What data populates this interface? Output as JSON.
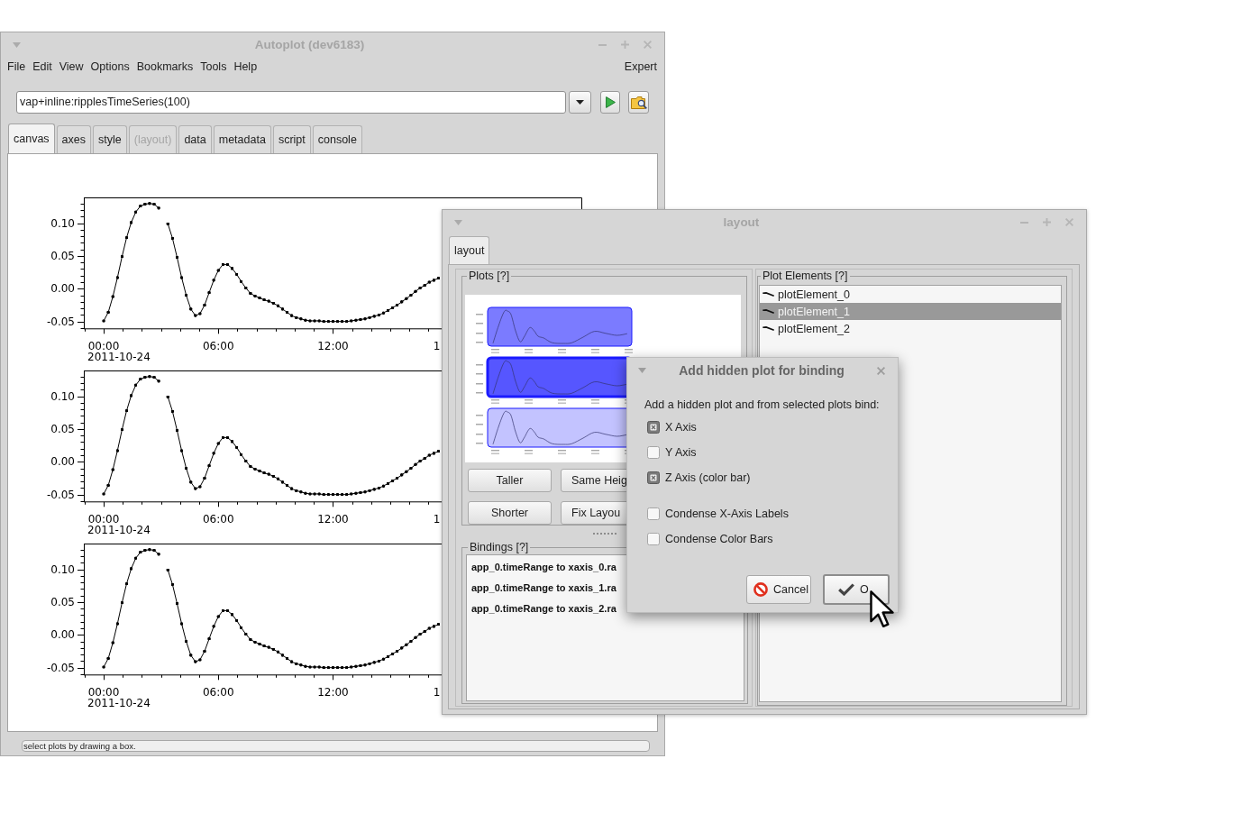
{
  "autoplot_window": {
    "title": "Autoplot (dev6183)",
    "menu": [
      "File",
      "Edit",
      "View",
      "Options",
      "Bookmarks",
      "Tools",
      "Help"
    ],
    "mode_menu": "Expert",
    "uri_field": {
      "value": "vap+inline:ripplesTimeSeries(100)"
    },
    "tabs": [
      {
        "label": "canvas",
        "selected": true,
        "disabled": false
      },
      {
        "label": "axes",
        "selected": false,
        "disabled": false
      },
      {
        "label": "style",
        "selected": false,
        "disabled": false
      },
      {
        "label": "(layout)",
        "selected": false,
        "disabled": true
      },
      {
        "label": "data",
        "selected": false,
        "disabled": false
      },
      {
        "label": "metadata",
        "selected": false,
        "disabled": false
      },
      {
        "label": "script",
        "selected": false,
        "disabled": false
      },
      {
        "label": "console",
        "selected": false,
        "disabled": false
      }
    ],
    "plots": [
      {
        "date_label": "2011-10-24",
        "cut_tick_label": "1",
        "chart_data": {
          "type": "line",
          "x": [
            0,
            0.24,
            0.48,
            0.72,
            0.96,
            1.2,
            1.44,
            1.68,
            1.92,
            2.16,
            2.4,
            2.64,
            2.88,
            3.12,
            3.36,
            3.6,
            3.84,
            4.08,
            4.32,
            4.56,
            4.8,
            5.04,
            5.28,
            5.52,
            5.76,
            6,
            6.24,
            6.48,
            6.72,
            6.96,
            7.2,
            7.44,
            7.68,
            7.92,
            8.16,
            8.4,
            8.64,
            8.88,
            9.12,
            9.36,
            9.6,
            9.84,
            10.08,
            10.32,
            10.56,
            10.8,
            11.04,
            11.28,
            11.52,
            11.76,
            12,
            12.24,
            12.48,
            12.72,
            12.96,
            13.2,
            13.44,
            13.68,
            13.92,
            14.16,
            14.4,
            14.64,
            14.88,
            15.12,
            15.36,
            15.6,
            15.84,
            16.08,
            16.32,
            16.56,
            16.8,
            17.04,
            17.28,
            17.52
          ],
          "values": [
            -0.049,
            -0.036,
            -0.012,
            0.017,
            0.049,
            0.078,
            0.101,
            0.117,
            0.126,
            0.129,
            0.13,
            0.129,
            0.123,
            null,
            0.099,
            0.077,
            0.048,
            0.017,
            -0.01,
            -0.031,
            -0.041,
            -0.038,
            -0.025,
            -0.006,
            0.013,
            0.028,
            0.037,
            0.037,
            0.031,
            0.022,
            0.011,
            0.001,
            -0.007,
            -0.011,
            -0.014,
            -0.017,
            -0.019,
            -0.022,
            -0.026,
            -0.031,
            -0.036,
            -0.041,
            -0.044,
            -0.046,
            -0.048,
            -0.049,
            -0.049,
            -0.049,
            -0.05,
            -0.05,
            -0.05,
            -0.05,
            -0.05,
            -0.05,
            -0.049,
            -0.048,
            -0.047,
            -0.046,
            -0.044,
            -0.042,
            -0.04,
            -0.037,
            -0.033,
            -0.029,
            -0.025,
            -0.02,
            -0.015,
            -0.01,
            -0.004,
            0.001,
            0.005,
            0.01,
            0.013,
            0.016
          ],
          "xlim": [
            -1.04,
            25
          ],
          "ylim": [
            -0.0605,
            0.1393
          ],
          "xticks": [
            {
              "value": 0,
              "label": "00:00"
            },
            {
              "value": 6,
              "label": "06:00"
            },
            {
              "value": 12,
              "label": "12:00"
            }
          ],
          "yticks": [
            {
              "value": -0.05,
              "label": "-0.05"
            },
            {
              "value": 0,
              "label": "0.00"
            },
            {
              "value": 0.05,
              "label": "0.05"
            },
            {
              "value": 0.1,
              "label": "0.10"
            }
          ]
        }
      },
      {
        "date_label": "2011-10-24",
        "cut_tick_label": "1",
        "chart_data": {
          "type": "line",
          "x": [
            0,
            0.24,
            0.48,
            0.72,
            0.96,
            1.2,
            1.44,
            1.68,
            1.92,
            2.16,
            2.4,
            2.64,
            2.88,
            3.12,
            3.36,
            3.6,
            3.84,
            4.08,
            4.32,
            4.56,
            4.8,
            5.04,
            5.28,
            5.52,
            5.76,
            6,
            6.24,
            6.48,
            6.72,
            6.96,
            7.2,
            7.44,
            7.68,
            7.92,
            8.16,
            8.4,
            8.64,
            8.88,
            9.12,
            9.36,
            9.6,
            9.84,
            10.08,
            10.32,
            10.56,
            10.8,
            11.04,
            11.28,
            11.52,
            11.76,
            12,
            12.24,
            12.48,
            12.72,
            12.96,
            13.2,
            13.44,
            13.68,
            13.92,
            14.16,
            14.4,
            14.64,
            14.88,
            15.12,
            15.36,
            15.6,
            15.84,
            16.08,
            16.32,
            16.56,
            16.8,
            17.04,
            17.28,
            17.52
          ],
          "values": [
            -0.049,
            -0.036,
            -0.012,
            0.017,
            0.049,
            0.078,
            0.101,
            0.117,
            0.126,
            0.129,
            0.13,
            0.129,
            0.123,
            null,
            0.099,
            0.077,
            0.048,
            0.017,
            -0.01,
            -0.031,
            -0.041,
            -0.038,
            -0.025,
            -0.006,
            0.013,
            0.028,
            0.037,
            0.037,
            0.031,
            0.022,
            0.011,
            0.001,
            -0.007,
            -0.011,
            -0.014,
            -0.017,
            -0.019,
            -0.022,
            -0.026,
            -0.031,
            -0.036,
            -0.041,
            -0.044,
            -0.046,
            -0.048,
            -0.049,
            -0.049,
            -0.049,
            -0.05,
            -0.05,
            -0.05,
            -0.05,
            -0.05,
            -0.05,
            -0.049,
            -0.048,
            -0.047,
            -0.046,
            -0.044,
            -0.042,
            -0.04,
            -0.037,
            -0.033,
            -0.029,
            -0.025,
            -0.02,
            -0.015,
            -0.01,
            -0.004,
            0.001,
            0.005,
            0.01,
            0.013,
            0.016
          ],
          "xlim": [
            -1.04,
            25
          ],
          "ylim": [
            -0.0605,
            0.1393
          ],
          "xticks": [
            {
              "value": 0,
              "label": "00:00"
            },
            {
              "value": 6,
              "label": "06:00"
            },
            {
              "value": 12,
              "label": "12:00"
            }
          ],
          "yticks": [
            {
              "value": -0.05,
              "label": "-0.05"
            },
            {
              "value": 0,
              "label": "0.00"
            },
            {
              "value": 0.05,
              "label": "0.05"
            },
            {
              "value": 0.1,
              "label": "0.10"
            }
          ]
        }
      },
      {
        "date_label": "2011-10-24",
        "cut_tick_label": "1",
        "chart_data": {
          "type": "line",
          "x": [
            0,
            0.24,
            0.48,
            0.72,
            0.96,
            1.2,
            1.44,
            1.68,
            1.92,
            2.16,
            2.4,
            2.64,
            2.88,
            3.12,
            3.36,
            3.6,
            3.84,
            4.08,
            4.32,
            4.56,
            4.8,
            5.04,
            5.28,
            5.52,
            5.76,
            6,
            6.24,
            6.48,
            6.72,
            6.96,
            7.2,
            7.44,
            7.68,
            7.92,
            8.16,
            8.4,
            8.64,
            8.88,
            9.12,
            9.36,
            9.6,
            9.84,
            10.08,
            10.32,
            10.56,
            10.8,
            11.04,
            11.28,
            11.52,
            11.76,
            12,
            12.24,
            12.48,
            12.72,
            12.96,
            13.2,
            13.44,
            13.68,
            13.92,
            14.16,
            14.4,
            14.64,
            14.88,
            15.12,
            15.36,
            15.6,
            15.84,
            16.08,
            16.32,
            16.56,
            16.8,
            17.04,
            17.28,
            17.52
          ],
          "values": [
            -0.049,
            -0.036,
            -0.012,
            0.017,
            0.049,
            0.078,
            0.101,
            0.117,
            0.126,
            0.129,
            0.13,
            0.129,
            0.123,
            null,
            0.099,
            0.077,
            0.048,
            0.017,
            -0.01,
            -0.031,
            -0.041,
            -0.038,
            -0.025,
            -0.006,
            0.013,
            0.028,
            0.037,
            0.037,
            0.031,
            0.022,
            0.011,
            0.001,
            -0.007,
            -0.011,
            -0.014,
            -0.017,
            -0.019,
            -0.022,
            -0.026,
            -0.031,
            -0.036,
            -0.041,
            -0.044,
            -0.046,
            -0.048,
            -0.049,
            -0.049,
            -0.049,
            -0.05,
            -0.05,
            -0.05,
            -0.05,
            -0.05,
            -0.05,
            -0.049,
            -0.048,
            -0.047,
            -0.046,
            -0.044,
            -0.042,
            -0.04,
            -0.037,
            -0.033,
            -0.029,
            -0.025,
            -0.02,
            -0.015,
            -0.01,
            -0.004,
            0.001,
            0.005,
            0.01,
            0.013,
            0.016
          ],
          "xlim": [
            -1.04,
            25
          ],
          "ylim": [
            -0.0605,
            0.1393
          ],
          "xticks": [
            {
              "value": 0,
              "label": "00:00"
            },
            {
              "value": 6,
              "label": "06:00"
            },
            {
              "value": 12,
              "label": "12:00"
            }
          ],
          "yticks": [
            {
              "value": -0.05,
              "label": "-0.05"
            },
            {
              "value": 0,
              "label": "0.00"
            },
            {
              "value": 0.05,
              "label": "0.05"
            },
            {
              "value": 0.1,
              "label": "0.10"
            }
          ]
        }
      }
    ],
    "status_bar": "select plots by drawing a box."
  },
  "layout_window": {
    "title": "layout",
    "tabs": [
      {
        "label": "layout",
        "selected": true
      }
    ],
    "plots_panel": {
      "title": "Plots [?]",
      "thumbnails": [
        {
          "selected": true,
          "current": false
        },
        {
          "selected": true,
          "current": true
        },
        {
          "selected": false,
          "current": false
        }
      ],
      "buttons": [
        "Taller",
        "Same Heig",
        "Shorter",
        "Fix Layou"
      ]
    },
    "bindings_panel": {
      "title": "Bindings [?]",
      "items": [
        "app_0.timeRange to xaxis_0.ra",
        "app_0.timeRange to xaxis_1.ra",
        "app_0.timeRange to xaxis_2.ra"
      ]
    },
    "plot_elements_panel": {
      "title": "Plot Elements [?]",
      "items": [
        {
          "label": "plotElement_0",
          "selected": false
        },
        {
          "label": "plotElement_1",
          "selected": true
        },
        {
          "label": "plotElement_2",
          "selected": false
        }
      ]
    }
  },
  "dialog": {
    "title": "Add hidden plot for binding",
    "prompt": "Add a hidden plot and from selected plots bind:",
    "option_groups": [
      {
        "options": [
          {
            "label": "X Axis",
            "checked": true
          },
          {
            "label": "Y Axis",
            "checked": false
          },
          {
            "label": "Z Axis (color bar)",
            "checked": true
          }
        ]
      },
      {
        "options": [
          {
            "label": "Condense X-Axis Labels",
            "checked": false
          },
          {
            "label": "Condense Color Bars",
            "checked": false
          }
        ]
      }
    ],
    "buttons": [
      {
        "label": "Cancel",
        "kind": "cancel",
        "default": false
      },
      {
        "label": "O",
        "kind": "ok",
        "default": true
      }
    ]
  }
}
